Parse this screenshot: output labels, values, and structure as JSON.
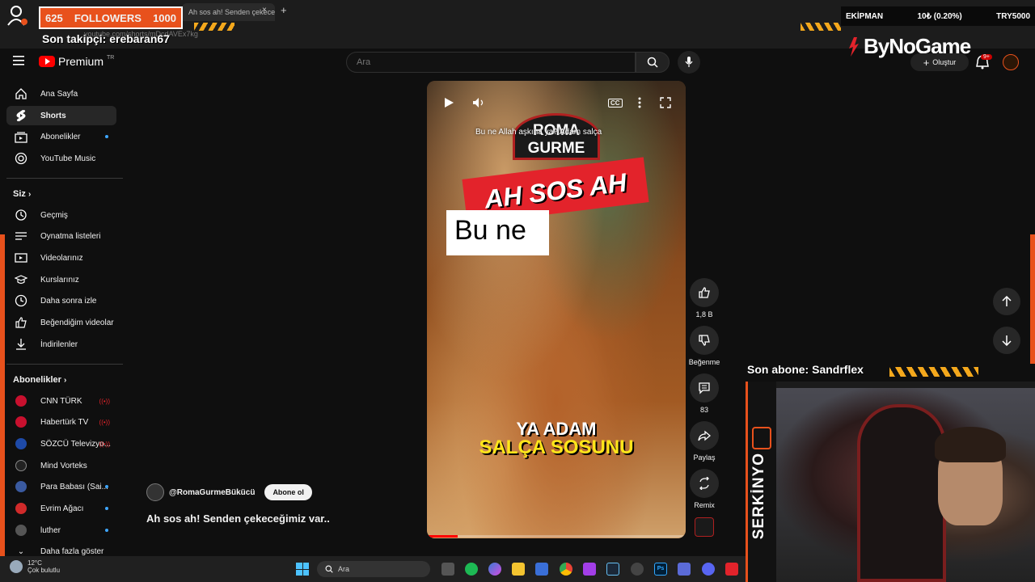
{
  "browser": {
    "tab_title": "Ah sos ah! Senden çekece",
    "tab_close": "×",
    "new_tab": "+",
    "url": "youtube.com/shorts/mDcdAVEx7kg"
  },
  "overlay": {
    "followers_count": "625",
    "followers_label": "FOLLOWERS",
    "followers_goal": "1000",
    "last_follower": "Son takipçi: erebaran67",
    "ticker_item": "EKİPMAN",
    "ticker_value": "10₺ (0.20%)",
    "ticker_code": "TRY5000",
    "sponsor": "ByNoGame",
    "last_subscriber": "Son abone: Sandrflex",
    "streamer_name": "SERKİNYO"
  },
  "header": {
    "logo_text": "Premium",
    "logo_region": "TR",
    "search_placeholder": "Ara",
    "create_label": "Oluştur",
    "notification_count": "9+"
  },
  "sidebar": {
    "main": [
      {
        "label": "Ana Sayfa",
        "icon": "home-icon"
      },
      {
        "label": "Shorts",
        "icon": "shorts-icon"
      },
      {
        "label": "Abonelikler",
        "icon": "subscriptions-icon"
      },
      {
        "label": "YouTube Music",
        "icon": "music-icon"
      }
    ],
    "you_section": "Siz",
    "you": [
      {
        "label": "Geçmiş"
      },
      {
        "label": "Oynatma listeleri"
      },
      {
        "label": "Videolarınız"
      },
      {
        "label": "Kurslarınız"
      },
      {
        "label": "Daha sonra izle"
      },
      {
        "label": "Beğendiğim videolar"
      },
      {
        "label": "İndirilenler"
      }
    ],
    "subs_section": "Abonelikler",
    "subs": [
      {
        "label": "CNN TÜRK",
        "color": "#c8102e"
      },
      {
        "label": "Habertürk TV",
        "color": "#c8102e"
      },
      {
        "label": "SÖZCÜ Televizyo...",
        "color": "#1e4aa8"
      },
      {
        "label": "Mind Vorteks",
        "color": "#222222"
      },
      {
        "label": "Para Babası (Sai...",
        "color": "#3a5aa0"
      },
      {
        "label": "Evrim Ağacı",
        "color": "#d02a2a"
      },
      {
        "label": "luther",
        "color": "#555555"
      }
    ],
    "show_more": "Daha fazla göster"
  },
  "video": {
    "caption": "Bu ne Allah aşkına ya? Adam salça",
    "sign": "ROMA GURME",
    "banner": "AH SOS AH",
    "box_text": "Bu ne",
    "subtitle_line1": "YA ADAM",
    "subtitle_line2": "SALÇA SOSUNU",
    "cc_label": "CC",
    "progress": 0.12
  },
  "actions": {
    "likes": "1,8 B",
    "dislike_label": "Beğenme",
    "comments": "83",
    "share_label": "Paylaş",
    "remix_label": "Remix"
  },
  "channel": {
    "handle": "@RomaGurmeBükücü",
    "subscribe_label": "Abone ol",
    "title": "Ah sos ah! Senden çekeceğimiz var.."
  },
  "taskbar": {
    "temperature": "12°C",
    "weather": "Çok bulutlu",
    "search_label": "Ara"
  },
  "colors": {
    "accent_orange": "#e8511c",
    "yt_red": "#ff0000"
  }
}
